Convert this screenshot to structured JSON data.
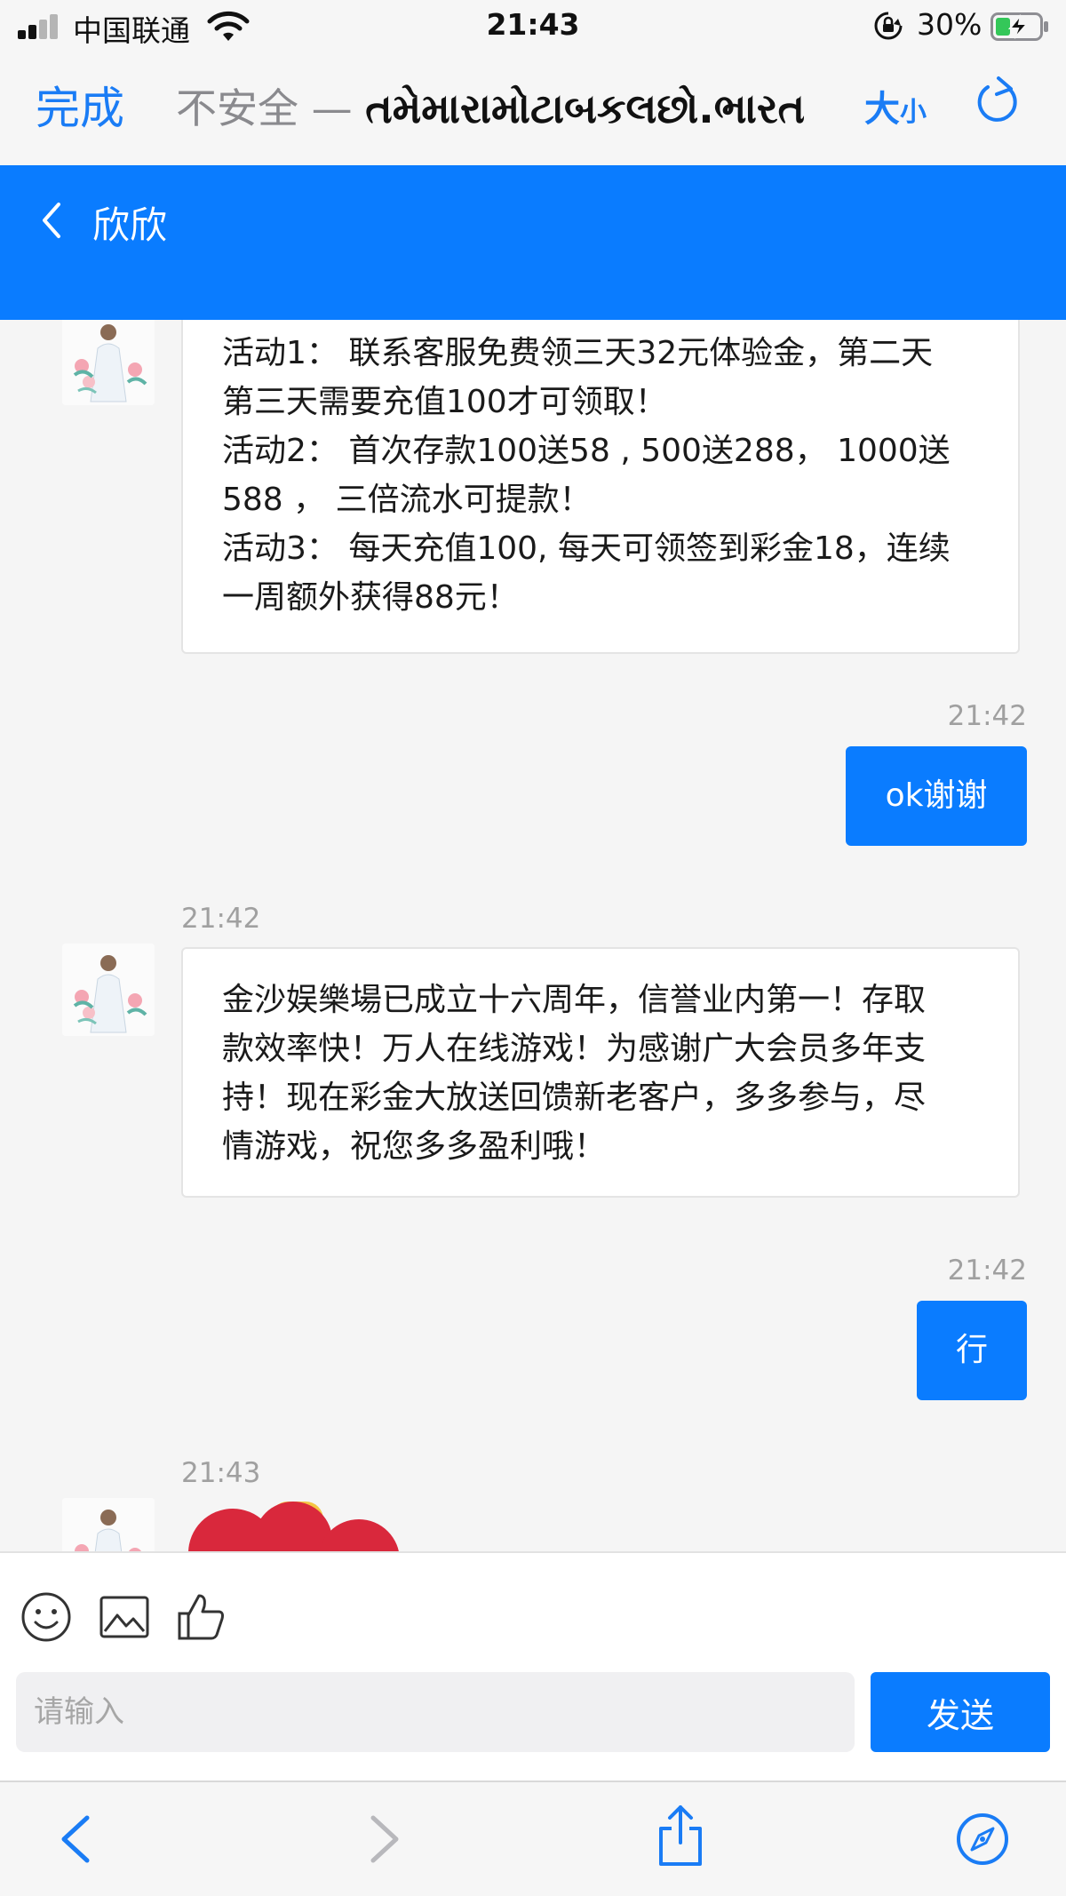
{
  "status_bar": {
    "carrier": "中国联通",
    "time": "21:43",
    "battery": "30%"
  },
  "browser": {
    "done_label": "完成",
    "security_label": "不安全 — ",
    "domain": "તમેમારામોટાબકલછો.ભારત",
    "text_size_big": "大",
    "text_size_small": "小"
  },
  "chat": {
    "title": "欣欣",
    "messages": [
      {
        "from": "agent",
        "lines": [
          "活动1： 联系客服免费领三天32元体验金，第二天",
          "第三天需要充值100才可领取！",
          "活动2： 首次存款100送58 , 500送288， 1000送",
          "588 ， 三倍流水可提款！",
          "活动3： 每天充值100, 每天可领签到彩金18，连续",
          "一周额外获得88元！"
        ]
      },
      {
        "from": "me",
        "time": "21:42",
        "text": "ok谢谢"
      },
      {
        "from": "agent",
        "time": "21:42",
        "lines": [
          "金沙娱樂場已成立十六周年，信誉业内第一！存取",
          "款效率快！万人在线游戏！为感谢广大会员多年支",
          "持！现在彩金大放送回馈新老客户，多多参与，尽",
          "情游戏，祝您多多盈利哦！"
        ]
      },
      {
        "from": "me",
        "time": "21:42",
        "text": "行"
      },
      {
        "from": "agent",
        "time": "21:43",
        "type": "emoji-image"
      }
    ]
  },
  "composer": {
    "placeholder": "请输入",
    "send_label": "发送",
    "icons": [
      "smiley-icon",
      "image-icon",
      "thumbs-up-icon"
    ]
  },
  "colors": {
    "accent": "#0a7cff",
    "ios_blue": "#1a7cf5"
  }
}
